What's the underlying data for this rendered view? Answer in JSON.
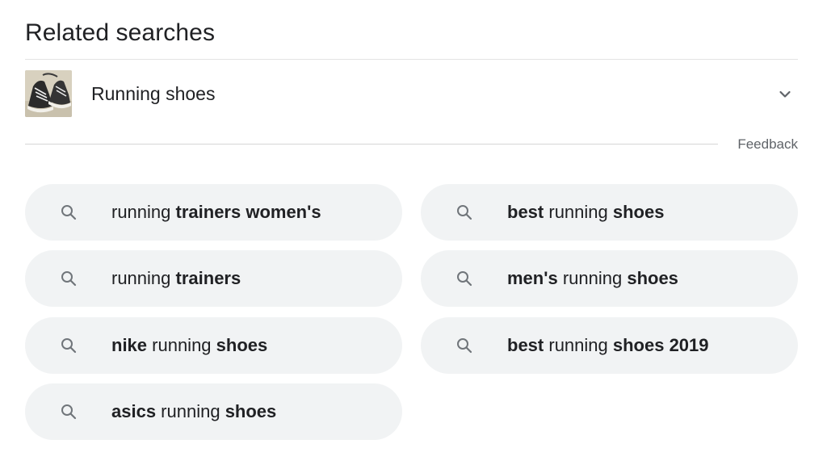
{
  "section": {
    "title": "Related searches"
  },
  "entity": {
    "label": "Running shoes",
    "thumbnail_icon": "sneakers-photo",
    "expand_icon": "chevron-down-icon"
  },
  "feedback": {
    "label": "Feedback"
  },
  "colors": {
    "pill_background": "#f1f3f4",
    "text": "#202124",
    "muted_text": "#5f6368",
    "divider": "#e3e3e3"
  },
  "suggestions": [
    {
      "segments": [
        {
          "text": "running ",
          "bold": false
        },
        {
          "text": "trainers women's",
          "bold": true
        }
      ]
    },
    {
      "segments": [
        {
          "text": "best",
          "bold": true
        },
        {
          "text": " running ",
          "bold": false
        },
        {
          "text": "shoes",
          "bold": true
        }
      ]
    },
    {
      "segments": [
        {
          "text": "running ",
          "bold": false
        },
        {
          "text": "trainers",
          "bold": true
        }
      ]
    },
    {
      "segments": [
        {
          "text": "men's",
          "bold": true
        },
        {
          "text": " running ",
          "bold": false
        },
        {
          "text": "shoes",
          "bold": true
        }
      ]
    },
    {
      "segments": [
        {
          "text": "nike",
          "bold": true
        },
        {
          "text": " running ",
          "bold": false
        },
        {
          "text": "shoes",
          "bold": true
        }
      ]
    },
    {
      "segments": [
        {
          "text": "best",
          "bold": true
        },
        {
          "text": " running ",
          "bold": false
        },
        {
          "text": "shoes 2019",
          "bold": true
        }
      ]
    },
    {
      "segments": [
        {
          "text": "asics",
          "bold": true
        },
        {
          "text": " running ",
          "bold": false
        },
        {
          "text": "shoes",
          "bold": true
        }
      ]
    }
  ]
}
